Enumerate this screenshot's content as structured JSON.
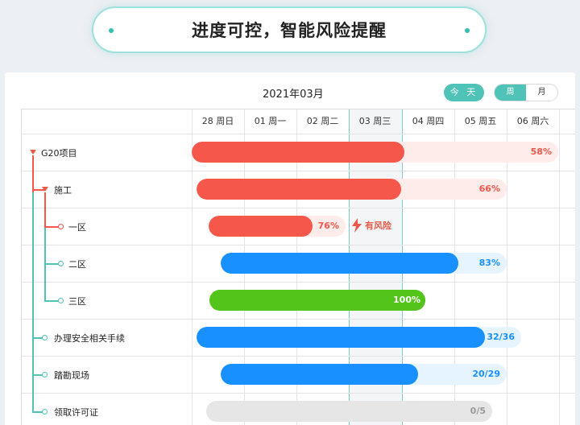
{
  "header": {
    "title": "进度可控，智能风险提醒"
  },
  "toolbar": {
    "month": "2021年03月",
    "today_label": "今 天",
    "view_week": "周",
    "view_month": "月"
  },
  "colors": {
    "red": "#f5574a",
    "red_track": "#fdecea",
    "blue": "#1890ff",
    "blue_track": "#e6f4ff",
    "green": "#52c41a",
    "gray": "#e6e6e6",
    "teal": "#4fc3b7"
  },
  "days": [
    "28 周日",
    "01 周一",
    "02 周二",
    "03 周三",
    "04 周四",
    "05 周五",
    "06 周六"
  ],
  "tasks": [
    {
      "name": "G20项目",
      "progress_text": "58%",
      "progress": 0.58,
      "color": "red"
    },
    {
      "name": "施工",
      "progress_text": "66%",
      "progress": 0.66,
      "color": "red"
    },
    {
      "name": "一区",
      "progress_text": "76%",
      "progress": 0.76,
      "color": "red",
      "risk": "有风险"
    },
    {
      "name": "二区",
      "progress_text": "83%",
      "progress": 0.83,
      "color": "blue"
    },
    {
      "name": "三区",
      "progress_text": "100%",
      "progress": 1.0,
      "color": "green"
    },
    {
      "name": "办理安全相关手续",
      "progress_text": "32/36",
      "progress": 0.889,
      "color": "blue"
    },
    {
      "name": "踏勘现场",
      "progress_text": "20/29",
      "progress": 0.69,
      "color": "blue"
    },
    {
      "name": "领取许可证",
      "progress_text": "0/5",
      "progress": 0.0,
      "color": "gray"
    }
  ]
}
